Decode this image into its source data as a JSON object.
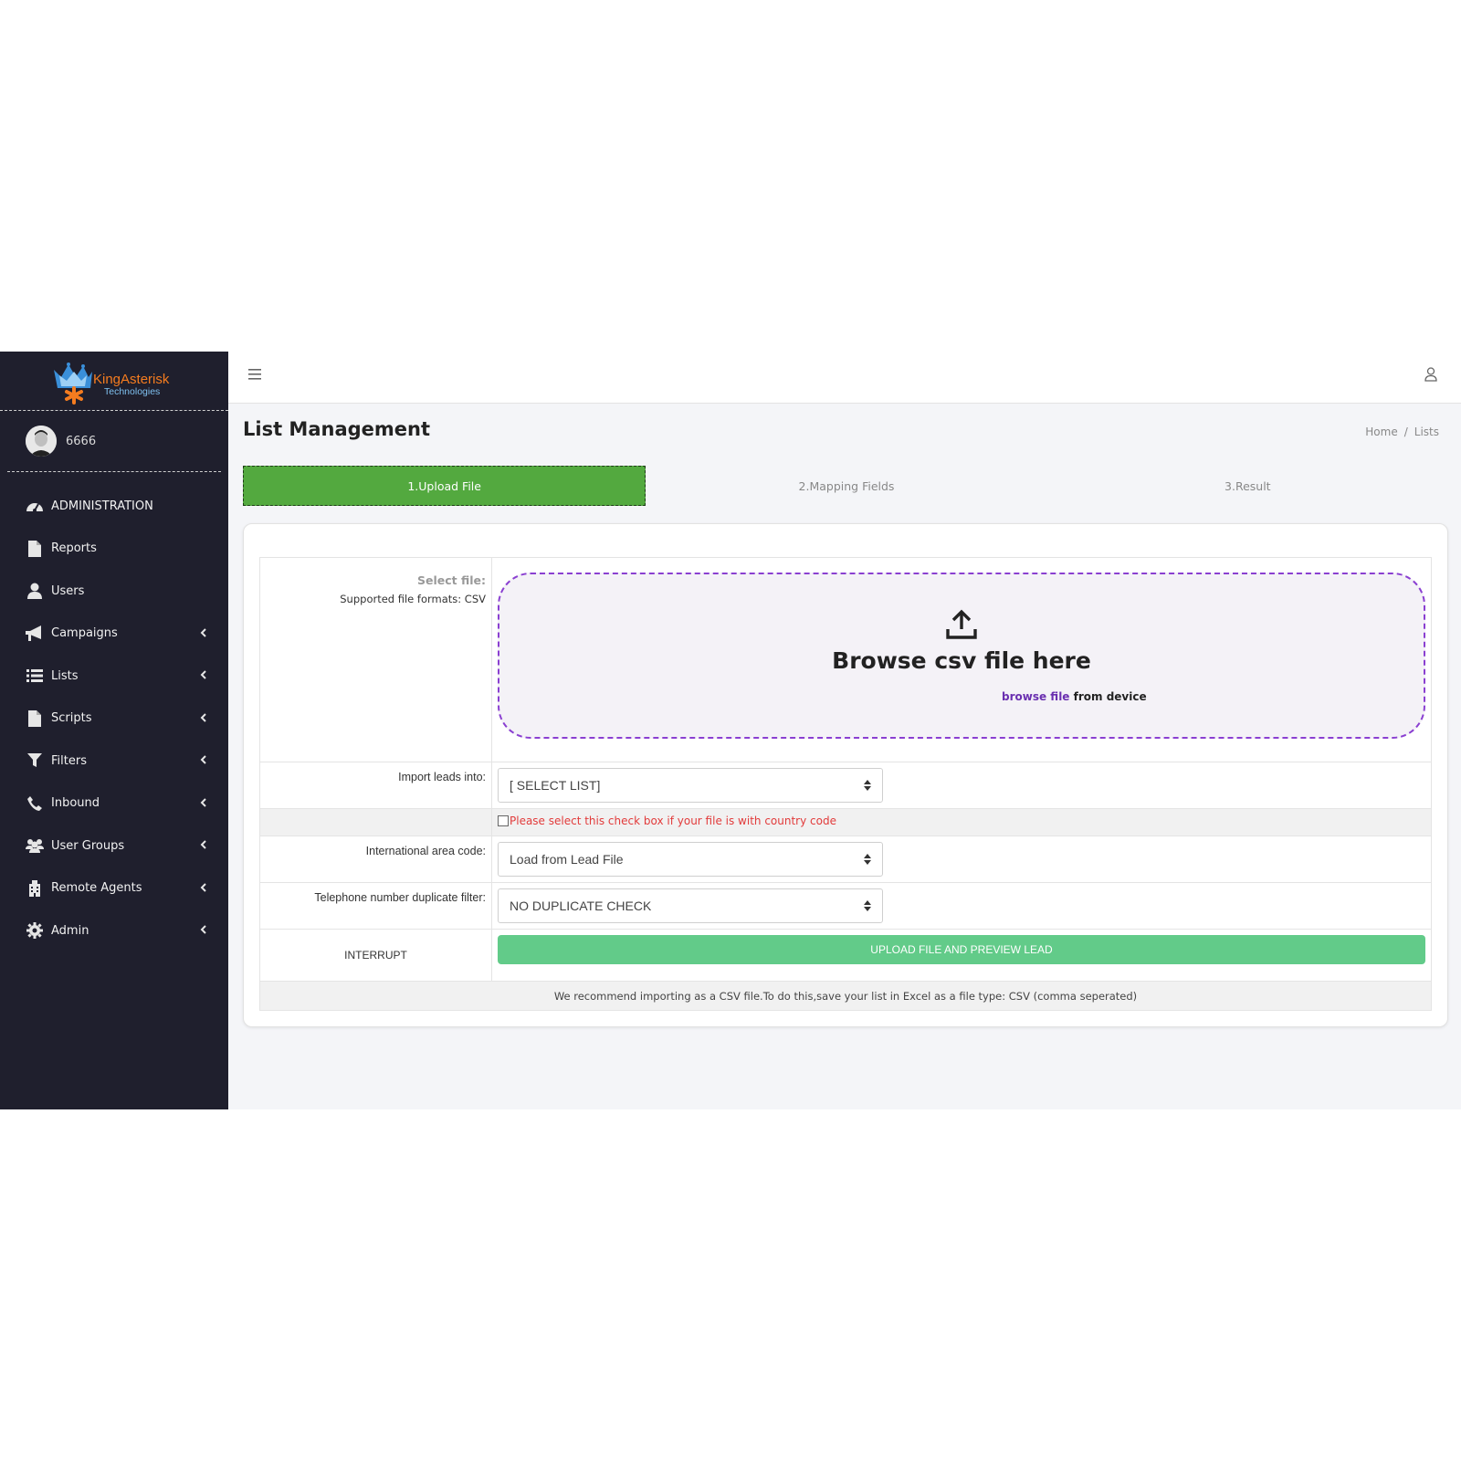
{
  "brand": {
    "name": "KingAsterisk",
    "tagline": "Technologies"
  },
  "user": {
    "name": "6666"
  },
  "sidebar": {
    "items": [
      {
        "label": "ADMINISTRATION",
        "icon": "dashboard-icon",
        "has_submenu": false
      },
      {
        "label": "Reports",
        "icon": "file-icon",
        "has_submenu": false
      },
      {
        "label": "Users",
        "icon": "user-icon",
        "has_submenu": false
      },
      {
        "label": "Campaigns",
        "icon": "bullhorn-icon",
        "has_submenu": true
      },
      {
        "label": "Lists",
        "icon": "list-icon",
        "has_submenu": true
      },
      {
        "label": "Scripts",
        "icon": "file-icon",
        "has_submenu": true
      },
      {
        "label": "Filters",
        "icon": "filter-icon",
        "has_submenu": true
      },
      {
        "label": "Inbound",
        "icon": "phone-icon",
        "has_submenu": true
      },
      {
        "label": "User Groups",
        "icon": "users-icon",
        "has_submenu": true
      },
      {
        "label": "Remote Agents",
        "icon": "building-icon",
        "has_submenu": true
      },
      {
        "label": "Admin",
        "icon": "gear-icon",
        "has_submenu": true
      }
    ]
  },
  "page": {
    "title": "List Management",
    "breadcrumb": [
      "Home",
      "Lists"
    ]
  },
  "steps": [
    "1.Upload File",
    "2.Mapping Fields",
    "3.Result"
  ],
  "active_step": 0,
  "form": {
    "select_file_label": "Select file:",
    "supported_formats": "Supported file formats: CSV",
    "dropzone_title": "Browse csv file here",
    "dropzone_link": "browse file",
    "dropzone_suffix": " from device",
    "import_leads_label": "Import leads into:",
    "import_leads_value": "[ SELECT LIST]",
    "country_code_note": "Please select this check box if your file is with country code",
    "country_code_checked": false,
    "intl_area_code_label": "International area code:",
    "intl_area_code_value": "Load from Lead File",
    "dup_filter_label": "Telephone number duplicate filter:",
    "dup_filter_value": "NO DUPLICATE CHECK",
    "interrupt_label": "INTERRUPT",
    "upload_button": "UPLOAD FILE AND PREVIEW LEAD",
    "footer_note": "We recommend importing as a CSV file.To do this,save your list in Excel as a file type: CSV (comma seperated)"
  },
  "colors": {
    "sidebar_bg": "#1f1f2d",
    "active_step": "#53a93f",
    "upload_button": "#62cb89",
    "dropzone_border": "#8a3fd1",
    "warning_text": "#e23b3b"
  }
}
